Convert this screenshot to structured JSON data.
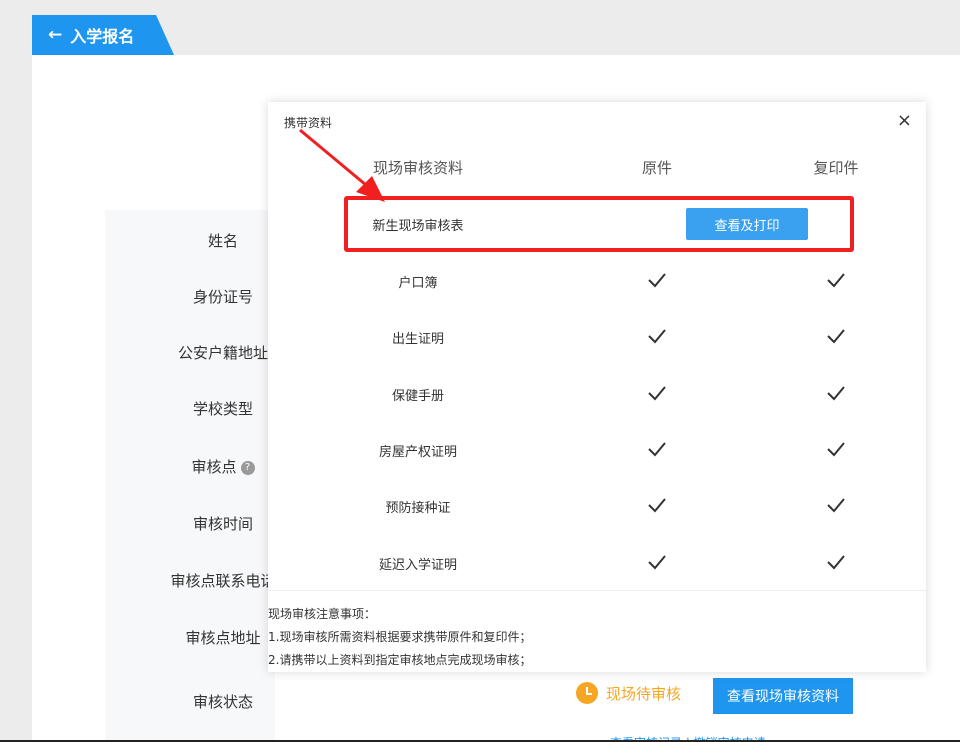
{
  "header": {
    "back_label": "入学报名"
  },
  "form": {
    "labels": [
      "姓名",
      "身份证号",
      "公安户籍地址",
      "学校类型",
      "审核点",
      "审核时间",
      "审核点联系电话",
      "审核点地址",
      "审核状态"
    ],
    "status_text": "现场待审核",
    "view_button": "查看现场审核资料",
    "bottom_links": "查看审核记录 | 撤销审核申请"
  },
  "modal": {
    "title": "携带资料",
    "close": "×",
    "columns": [
      "现场审核资料",
      "原件",
      "复印件"
    ],
    "highlight_row": {
      "label": "新生现场审核表",
      "button": "查看及打印"
    },
    "rows": [
      {
        "label": "户口簿",
        "original": true,
        "copy": true
      },
      {
        "label": "出生证明",
        "original": true,
        "copy": true
      },
      {
        "label": "保健手册",
        "original": true,
        "copy": true
      },
      {
        "label": "房屋产权证明",
        "original": true,
        "copy": true
      },
      {
        "label": "预防接种证",
        "original": true,
        "copy": true
      },
      {
        "label": "延迟入学证明",
        "original": true,
        "copy": true
      }
    ],
    "notes_title": "现场审核注意事项：",
    "notes": [
      "1.现场审核所需资料根据要求携带原件和复印件；",
      "2.请携带以上资料到指定审核地点完成现场审核；"
    ]
  },
  "colors": {
    "accent": "#1e95ee",
    "warning": "#f5a623",
    "annotation": "#f02020"
  }
}
